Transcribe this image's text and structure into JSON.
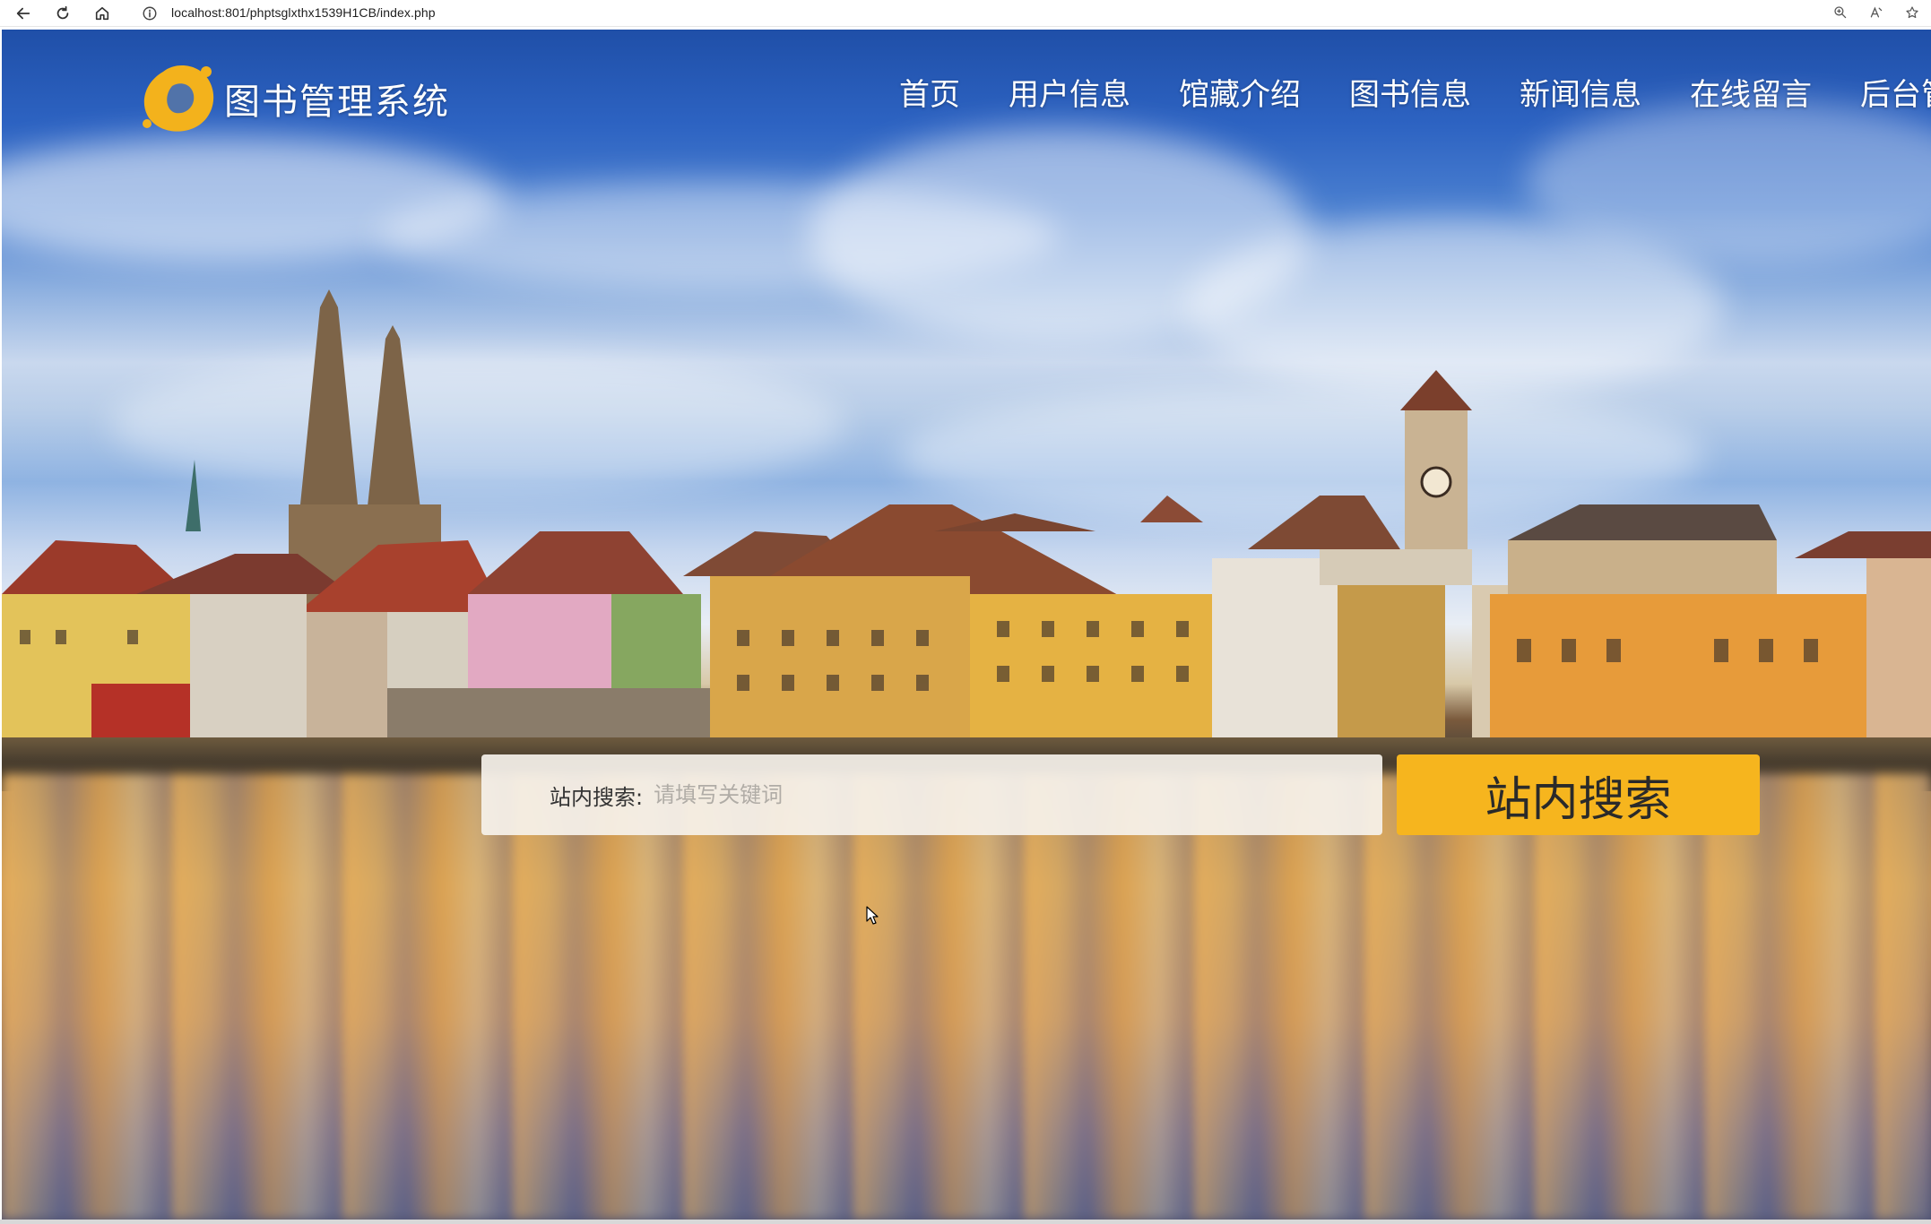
{
  "browser": {
    "url": "localhost:801/phptsglxthx1539H1CB/index.php",
    "icons": [
      "back-icon",
      "reload-icon",
      "home-icon",
      "info-icon",
      "zoom-icon",
      "read-aloud-icon",
      "favorite-icon"
    ]
  },
  "header": {
    "site_title": "图书管理系统",
    "nav": [
      "首页",
      "用户信息",
      "馆藏介绍",
      "图书信息",
      "新闻信息",
      "在线留言",
      "后台管"
    ]
  },
  "search": {
    "label": "站内搜索:",
    "placeholder": "请填写关键词",
    "button_label": "站内搜索"
  },
  "colors": {
    "accent": "#f6b51e",
    "nav_text": "#ffffff",
    "search_box_bg": "#f6f2ec"
  }
}
